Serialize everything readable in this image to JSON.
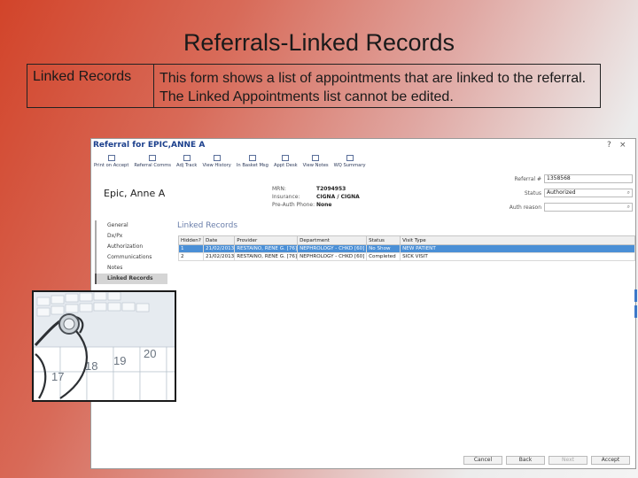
{
  "slide": {
    "title": "Referrals-Linked Records",
    "term": "Linked Records",
    "description": "This form shows a list of appointments that are linked to the referral. The Linked Appointments list cannot be edited."
  },
  "window": {
    "title": "Referral for EPIC,ANNE A",
    "help": "?",
    "close": "×",
    "toolbar": [
      "Print on Accept",
      "Referral Comms",
      "Adj Track",
      "View History",
      "In Basket Msg",
      "Appt Desk",
      "View Notes",
      "WQ Summary"
    ],
    "patient_name": "Epic, Anne A",
    "meta": [
      {
        "k": "MRN:",
        "v": "T2094953"
      },
      {
        "k": "Insurance:",
        "v": "CIGNA / CIGNA"
      },
      {
        "k": "Pre-Auth Phone:",
        "v": "None"
      }
    ],
    "fields": {
      "referral_label": "Referral #",
      "referral_value": "1358568",
      "status_label": "Status",
      "status_value": "Authorized",
      "auth_label": "Auth reason",
      "auth_value": ""
    },
    "nav": [
      "General",
      "Dx/Px",
      "Authorization",
      "Communications",
      "Notes",
      "Linked Records"
    ],
    "nav_active": "Linked Records",
    "section_title": "Linked Records",
    "grid": {
      "headers": [
        "Hidden?",
        "Date",
        "Provider",
        "Department",
        "Status",
        "Visit Type"
      ],
      "rows": [
        [
          "1",
          "21/02/2013",
          "RESTAINO, RENE G. [76]",
          "NEPHROLOGY - CHKD [60]",
          "No Show",
          "NEW PATIENT"
        ],
        [
          "2",
          "21/02/2013",
          "RESTAINO, RENE G. [76]",
          "NEPHROLOGY - CHKD [60]",
          "Completed",
          "SICK VISIT"
        ]
      ]
    },
    "footer": [
      "Cancel",
      "Back",
      "Next",
      "Accept"
    ]
  },
  "photo": {
    "calendar_numbers": [
      "17",
      "18",
      "19",
      "20"
    ]
  }
}
